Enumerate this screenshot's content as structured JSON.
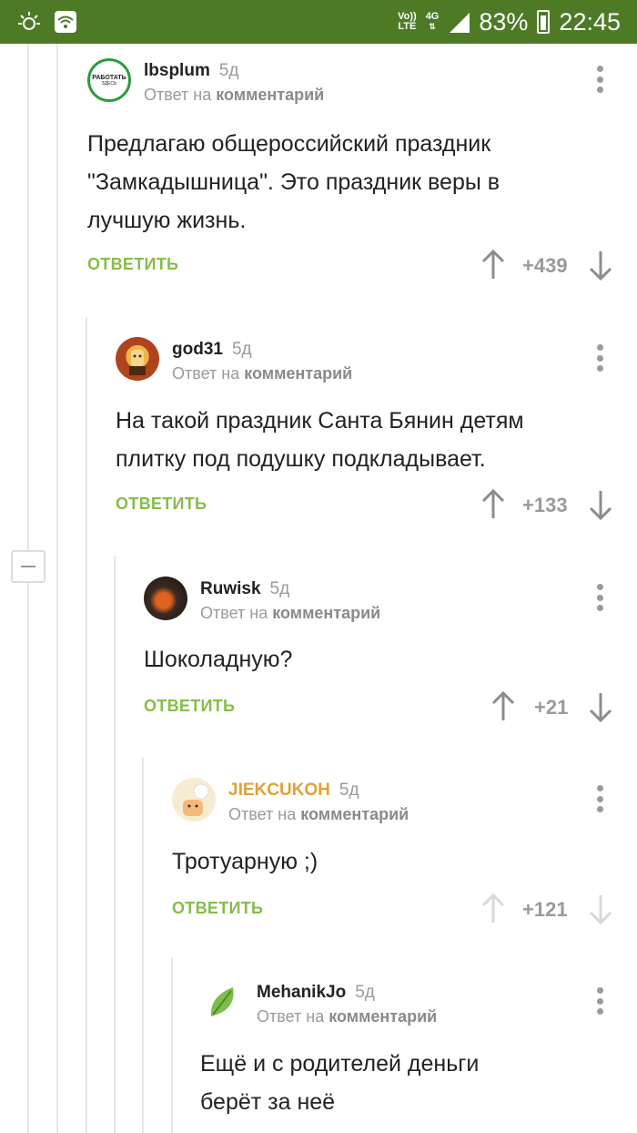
{
  "statusbar": {
    "network_top": "Vo))",
    "network_bottom": "LTE",
    "gen": "4G",
    "battery": "83%",
    "time": "22:45"
  },
  "common": {
    "reply_prefix": "Ответ на",
    "reply_target": "комментарий",
    "reply_button": "ОТВЕТИТЬ"
  },
  "comments": [
    {
      "user": "lbsplum",
      "time": "5д",
      "avatar_text_1": "РАБОТАТЬ",
      "avatar_text_2": "ЗДЕСЬ",
      "lines": [
        "Предлагаю общероссийский праздник",
        "\"Замкадышница\". Это праздник веры в",
        "лучшую жизнь."
      ],
      "score": "+439"
    },
    {
      "user": "god31",
      "time": "5д",
      "lines": [
        "На такой праздник Санта Бянин детям",
        "плитку под подушку подкладывает."
      ],
      "score": "+133"
    },
    {
      "user": "Ruwisk",
      "time": "5д",
      "lines": [
        "Шоколадную?"
      ],
      "score": "+21"
    },
    {
      "user": "JIEKCUKOH",
      "time": "5д",
      "user_color": "#e1a13a",
      "lines": [
        "Тротуарную ;)"
      ],
      "score": "+121"
    },
    {
      "user": "MehanikJo",
      "time": "5д",
      "lines": [
        "Ещё и с родителей деньги",
        "берёт за неё"
      ]
    }
  ]
}
